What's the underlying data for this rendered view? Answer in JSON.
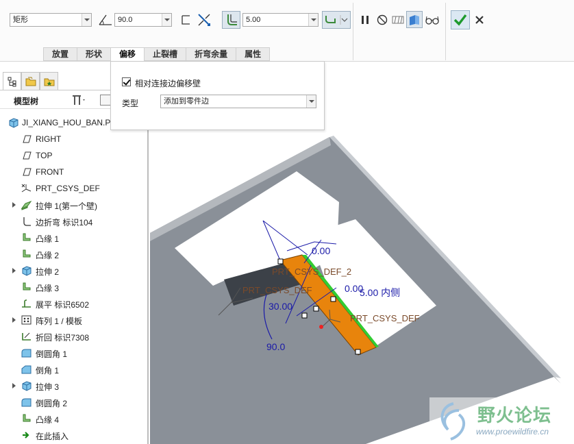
{
  "dashboard": {
    "shape_select": "矩形",
    "angle_value": "90.0",
    "length_value": "5.00",
    "ok_label": "✔",
    "cancel_label": "✕"
  },
  "tabs": [
    {
      "label": "放置"
    },
    {
      "label": "形状"
    },
    {
      "label": "偏移"
    },
    {
      "label": "止裂槽"
    },
    {
      "label": "折弯余量"
    },
    {
      "label": "属性"
    }
  ],
  "offset_panel": {
    "checkbox_label": "相对连接边偏移壁",
    "type_label": "类型",
    "type_value": "添加到零件边"
  },
  "navigator": {
    "title": "模型树",
    "items": [
      {
        "label": "JI_XIANG_HOU_BAN.PI",
        "icon": "part-icon"
      },
      {
        "label": "RIGHT",
        "icon": "datum-plane-icon"
      },
      {
        "label": "TOP",
        "icon": "datum-plane-icon"
      },
      {
        "label": "FRONT",
        "icon": "datum-plane-icon"
      },
      {
        "label": "PRT_CSYS_DEF",
        "icon": "csys-icon"
      },
      {
        "label": "拉伸 1(第一个壁)",
        "icon": "extrude-wall-icon"
      },
      {
        "label": "边折弯 标识104",
        "icon": "edge-bend-icon"
      },
      {
        "label": "凸缘 1",
        "icon": "flange-icon"
      },
      {
        "label": "凸缘 2",
        "icon": "flange-icon"
      },
      {
        "label": "拉伸 2",
        "icon": "extrude-icon"
      },
      {
        "label": "凸缘 3",
        "icon": "flange-icon"
      },
      {
        "label": "展平 标识6502",
        "icon": "unbend-icon"
      },
      {
        "label": "阵列 1 / 模板",
        "icon": "pattern-icon"
      },
      {
        "label": "折回 标识7308",
        "icon": "bend-back-icon"
      },
      {
        "label": "倒圆角 1",
        "icon": "round-icon"
      },
      {
        "label": "倒角 1",
        "icon": "chamfer-icon"
      },
      {
        "label": "拉伸 3",
        "icon": "extrude-icon"
      },
      {
        "label": "倒圆角 2",
        "icon": "round-icon"
      },
      {
        "label": "凸缘 4",
        "icon": "flange-icon"
      },
      {
        "label": "在此插入",
        "icon": "insert-here-icon"
      }
    ]
  },
  "graphics": {
    "dim_a": "0.00",
    "dim_b": "0.00",
    "dim_c": "5.00 内侧",
    "dim_angle_30": "30.00",
    "dim_angle_90": "90.0",
    "csys_label_1": "PRT_CSYS_DEF_2",
    "csys_label_2": "PRT_CSYS_DEF",
    "csys_label_3": "PRT_CSYS_DEF"
  },
  "watermark": {
    "text": "野火论坛",
    "url": "www.proewildfire.cn"
  },
  "colors": {
    "part_gray": "#8a9098",
    "flange_orange": "#e8840c",
    "dim_blue": "#1a1aa8",
    "edge_green": "#33cc33"
  }
}
